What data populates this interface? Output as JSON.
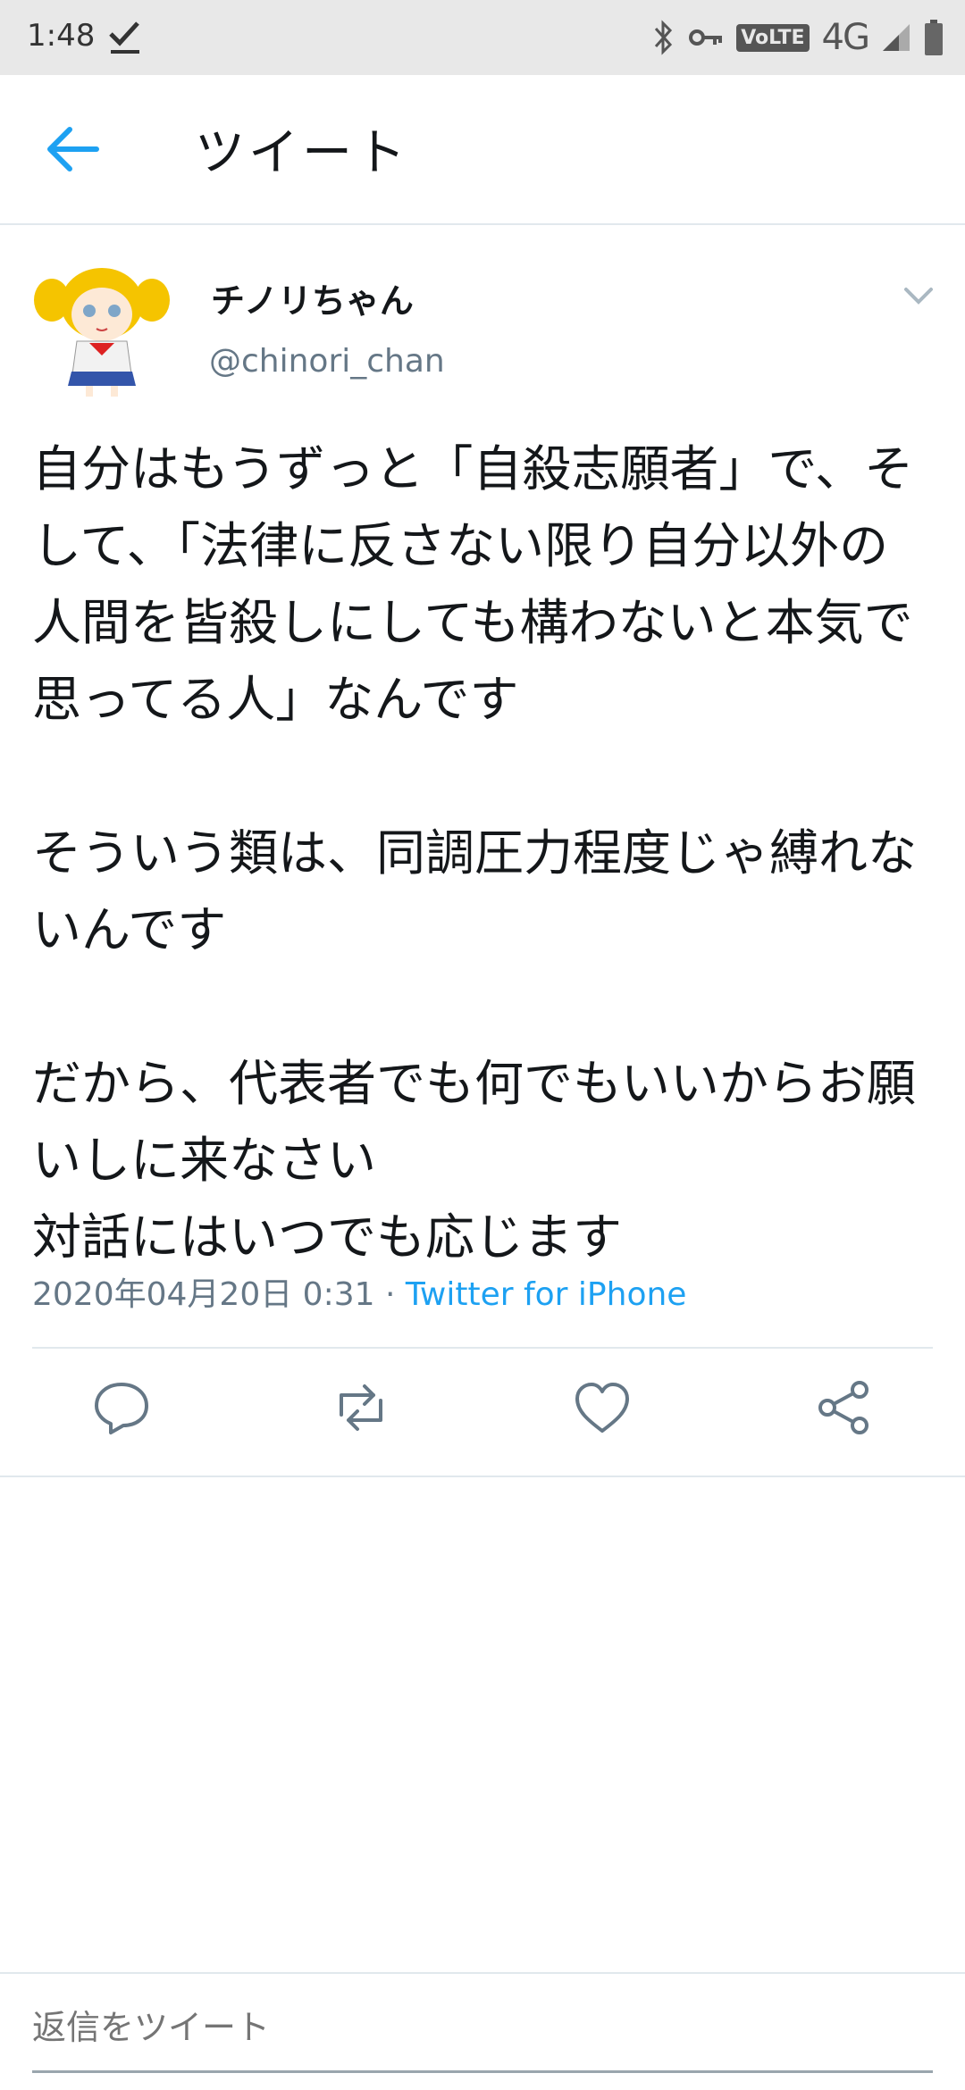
{
  "status_bar": {
    "time": "1:48",
    "icons": [
      "download-done-icon",
      "bluetooth-icon",
      "vpn-key-icon",
      "volte-icon",
      "signal-4g-icon",
      "battery-icon"
    ],
    "volte_label": "VoLTE",
    "network_label": "4G"
  },
  "header": {
    "title": "ツイート",
    "back_icon": "arrow-left-icon",
    "accent": "#1da1f2"
  },
  "tweet": {
    "display_name": "チノリちゃん",
    "handle": "@chinori_chan",
    "paragraphs": [
      [
        "自分はもうずっと「自殺志願者」で、そ",
        "して、「法律に反さない限り自分以外の",
        "人間を皆殺しにしても構わないと本気で",
        "思ってる人」なんです"
      ],
      [
        "そういう類は、同調圧力程度じゃ縛れな",
        "いんです"
      ],
      [
        "だから、代表者でも何でもいいからお願",
        "いしに来なさい",
        "対話にはいつでも応じます"
      ]
    ],
    "timestamp": "2020年04月20日 0:31",
    "separator": " · ",
    "source": "Twitter for iPhone"
  },
  "actions": [
    "reply-icon",
    "retweet-icon",
    "like-icon",
    "share-icon"
  ],
  "reply": {
    "placeholder": "返信をツイート"
  }
}
